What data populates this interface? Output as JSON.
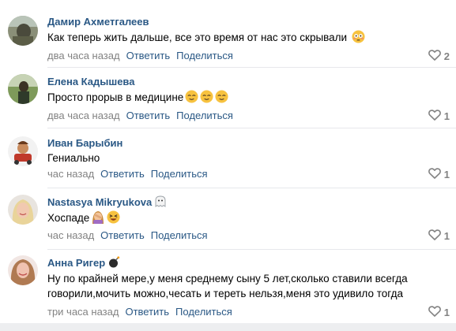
{
  "comments": [
    {
      "author": "Дамир Ахметгалеев",
      "text": "Как теперь жить дальше, все это время от нас это скрывали",
      "text_emojis": [
        "flushed-face"
      ],
      "time": "два часа назад",
      "reply": "Ответить",
      "share": "Поделиться",
      "likes": "2"
    },
    {
      "author": "Елена Кадышева",
      "text": "Просто прорыв в медицине",
      "text_emojis": [
        "relieved-face",
        "relieved-face",
        "relieved-face"
      ],
      "time": "два часа назад",
      "reply": "Ответить",
      "share": "Поделиться",
      "likes": "1"
    },
    {
      "author": "Иван Барыбин",
      "text": "Гениально",
      "text_emojis": [],
      "time": "час назад",
      "reply": "Ответить",
      "share": "Поделиться",
      "likes": "1"
    },
    {
      "author": "Nastasya Mikryukova",
      "author_badge": "ghost-icon",
      "text": "Хоспаде",
      "text_emojis": [
        "facepalm-woman",
        "laughing-face"
      ],
      "time": "час назад",
      "reply": "Ответить",
      "share": "Поделиться",
      "likes": "1"
    },
    {
      "author": "Анна Ригер",
      "author_badge": "bomb-icon",
      "text_line1": "Ну по крайней мере,у меня среднему сыну 5 лет,сколько ставили всегда",
      "text_line2": "говорили,мочить можно,чесать и тереть нельзя,меня это удивило тогда",
      "time": "три часа назад",
      "reply": "Ответить",
      "share": "Поделиться",
      "likes": "1"
    }
  ],
  "colors": {
    "link": "#2a5885",
    "meta": "#828282",
    "divider": "#e7e8ec"
  }
}
